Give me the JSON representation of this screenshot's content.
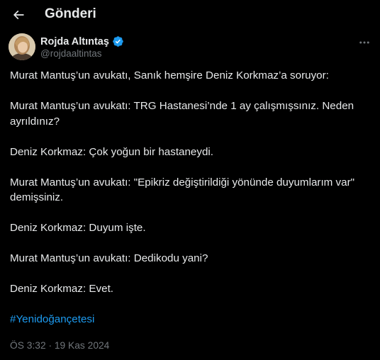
{
  "header": {
    "back_icon": "arrow-left-icon",
    "title": "Gönderi"
  },
  "author": {
    "display_name": "Rojda Altıntaş",
    "verified_icon": "verified-badge-icon",
    "verified_color": "#1d9bf0",
    "handle": "@rojdaaltintas",
    "more_icon": "more-dots-icon"
  },
  "tweet": {
    "paragraphs": [
      "Murat Mantuş’un avukatı, Sanık hemşire Deniz Korkmaz’a soruyor:",
      "Murat Mantuş’un avukatı: TRG Hastanesi’nde 1 ay çalışmışsınız. Neden ayrıldınız?",
      "Deniz Korkmaz: Çok yoğun bir hastaneydi.",
      "Murat Mantuş’un avukatı: \"Epikriz değiştirildiği yönünde duyumlarım var\" demişsiniz.",
      "Deniz Korkmaz: Duyum işte.",
      "Murat Mantuş’un avukatı: Dedikodu yani?",
      "Deniz Korkmaz: Evet."
    ],
    "hashtag": "#Yenidoğançetesi",
    "hashtag_color": "#1d9bf0",
    "timestamp": "ÖS 3:32 · 19 Kas 2024"
  }
}
